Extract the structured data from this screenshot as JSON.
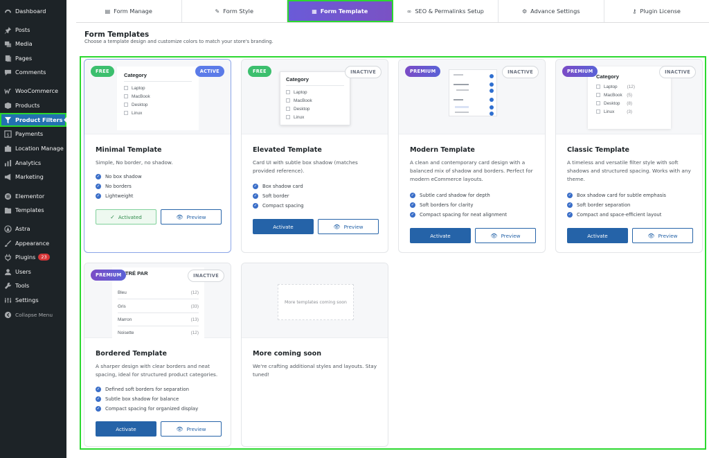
{
  "sidebar": {
    "items": [
      {
        "label": "Dashboard",
        "icon": "dashboard-icon"
      },
      {
        "label": "Posts",
        "icon": "pin-icon"
      },
      {
        "label": "Media",
        "icon": "media-icon"
      },
      {
        "label": "Pages",
        "icon": "pages-icon"
      },
      {
        "label": "Comments",
        "icon": "comments-icon"
      },
      {
        "label": "WooCommerce",
        "icon": "woo-icon"
      },
      {
        "label": "Products",
        "icon": "products-icon"
      },
      {
        "label": "Product Filters",
        "icon": "filter-icon"
      },
      {
        "label": "Payments",
        "icon": "payments-icon"
      },
      {
        "label": "Location Manage",
        "icon": "location-icon"
      },
      {
        "label": "Analytics",
        "icon": "analytics-icon"
      },
      {
        "label": "Marketing",
        "icon": "marketing-icon"
      },
      {
        "label": "Elementor",
        "icon": "elementor-icon"
      },
      {
        "label": "Templates",
        "icon": "templates-icon"
      },
      {
        "label": "Astra",
        "icon": "astra-icon"
      },
      {
        "label": "Appearance",
        "icon": "appearance-icon"
      },
      {
        "label": "Plugins",
        "icon": "plugins-icon",
        "badge": "23"
      },
      {
        "label": "Users",
        "icon": "users-icon"
      },
      {
        "label": "Tools",
        "icon": "tools-icon"
      },
      {
        "label": "Settings",
        "icon": "settings-icon"
      },
      {
        "label": "Collapse Menu",
        "icon": "collapse-icon"
      }
    ]
  },
  "tabs": [
    {
      "label": "Form Manage",
      "icon": "form-manage-icon"
    },
    {
      "label": "Form Style",
      "icon": "brush-icon"
    },
    {
      "label": "Form Template",
      "icon": "template-icon"
    },
    {
      "label": "SEO & Permalinks Setup",
      "icon": "link-icon"
    },
    {
      "label": "Advance Settings",
      "icon": "gear-icon"
    },
    {
      "label": "Plugin License",
      "icon": "key-icon"
    }
  ],
  "page": {
    "title": "Form Templates",
    "subtitle": "Choose a template design and customize colors to match your store's branding."
  },
  "cards": [
    {
      "badge": "FREE",
      "status": "ACTIVE",
      "title": "Minimal Template",
      "desc": "Simple, No border, no shadow.",
      "features": [
        "No box shadow",
        "No borders",
        "Lightweight"
      ],
      "primary": "Activated",
      "preview": "Preview",
      "mini": {
        "title": "Category",
        "rows": [
          "Laptop",
          "MacBook",
          "Desktop",
          "Linux"
        ]
      }
    },
    {
      "badge": "FREE",
      "status": "INACTIVE",
      "title": "Elevated Template",
      "desc": "Card UI with subtle box shadow (matches provided reference).",
      "features": [
        "Box shadow card",
        "Soft border",
        "Compact spacing"
      ],
      "primary": "Activate",
      "preview": "Preview",
      "mini": {
        "title": "Category",
        "rows": [
          "Laptop",
          "MacBook",
          "Desktop",
          "Linux"
        ]
      }
    },
    {
      "badge": "PREMIUM",
      "status": "INACTIVE",
      "title": "Modern Template",
      "desc": "A clean and contemporary card design with a balanced mix of shadow and borders. Perfect for modern eCommerce layouts.",
      "features": [
        "Subtle card shadow for depth",
        "Soft borders for clarity",
        "Compact spacing for neat alignment"
      ],
      "primary": "Activate",
      "preview": "Preview"
    },
    {
      "badge": "PREMIUM",
      "status": "INACTIVE",
      "title": "Classic Template",
      "desc": "A timeless and versatile filter style with soft shadows and structured spacing. Works with any theme.",
      "features": [
        "Box shadow card for subtle emphasis",
        "Soft border separation",
        "Compact and space-efficient layout"
      ],
      "primary": "Activate",
      "preview": "Preview",
      "mini": {
        "title": "Category",
        "rows": [
          {
            "label": "Laptop",
            "count": "(12)"
          },
          {
            "label": "MacBook",
            "count": "(5)"
          },
          {
            "label": "Desktop",
            "count": "(8)"
          },
          {
            "label": "Linux",
            "count": "(3)"
          }
        ]
      }
    },
    {
      "badge": "PREMIUM",
      "status": "INACTIVE",
      "title": "Bordered Template",
      "desc": "A sharper design with clear borders and neat spacing, ideal for structured product categories.",
      "features": [
        "Defined soft borders for separation",
        "Subtle box shadow for balance",
        "Compact spacing for organized display"
      ],
      "primary": "Activate",
      "preview": "Preview",
      "mini": {
        "title": "FILTRÉ PAR",
        "rows": [
          {
            "label": "Bleu",
            "count": "(12)"
          },
          {
            "label": "Gris",
            "count": "(33)"
          },
          {
            "label": "Marron",
            "count": "(13)"
          },
          {
            "label": "Noisette",
            "count": "(12)"
          }
        ]
      }
    },
    {
      "title": "More coming soon",
      "desc": "We're crafting additional styles and layouts. Stay tuned!",
      "placeholder": "More templates coming soon"
    }
  ],
  "colors": {
    "sidebar_bg": "#1d2327",
    "wp_blue": "#2271b1",
    "tab_active": "#6a5bd8",
    "highlight": "#2bd82f",
    "free": "#3cbf6e",
    "activate": "#2563a8"
  }
}
